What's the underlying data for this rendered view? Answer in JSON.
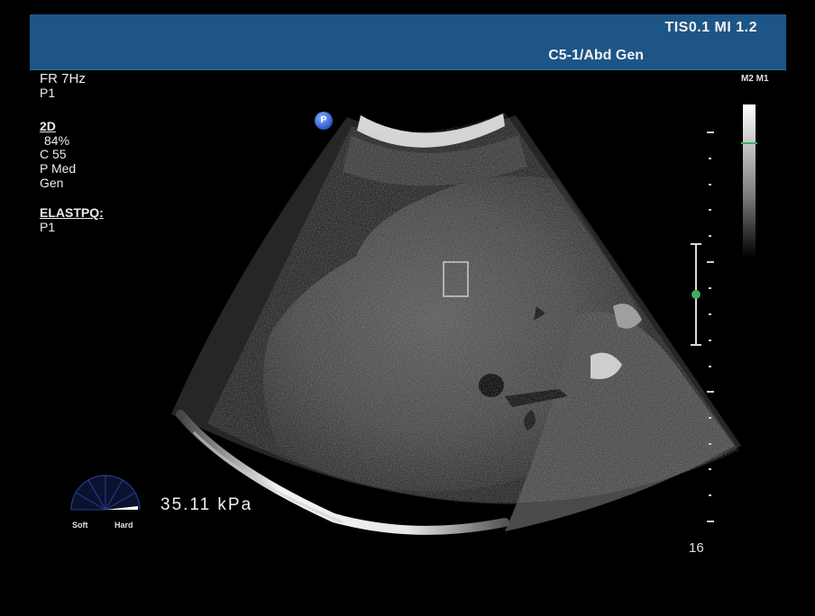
{
  "header": {
    "tis_mi": "TIS0.1   MI 1.2",
    "probe_preset": "C5-1/Abd Gen"
  },
  "left_panel": {
    "frame_rate": "FR 7Hz",
    "preset_p": "P1",
    "mode_2d": "2D",
    "gain": "84%",
    "compression": "C 55",
    "penetration": "P Med",
    "general": "Gen",
    "elast_label": "ELASTPQ:",
    "elast_p": "P1"
  },
  "grayscale": {
    "label": "M2 M1"
  },
  "depth": {
    "label": "16"
  },
  "elastography": {
    "value": "35.11 kPa",
    "soft_label": "Soft",
    "hard_label": "Hard"
  },
  "probe_badge": {
    "label": "P"
  },
  "colors": {
    "top_bar": "#1d5586",
    "focus_marker": "#3fae5b"
  }
}
